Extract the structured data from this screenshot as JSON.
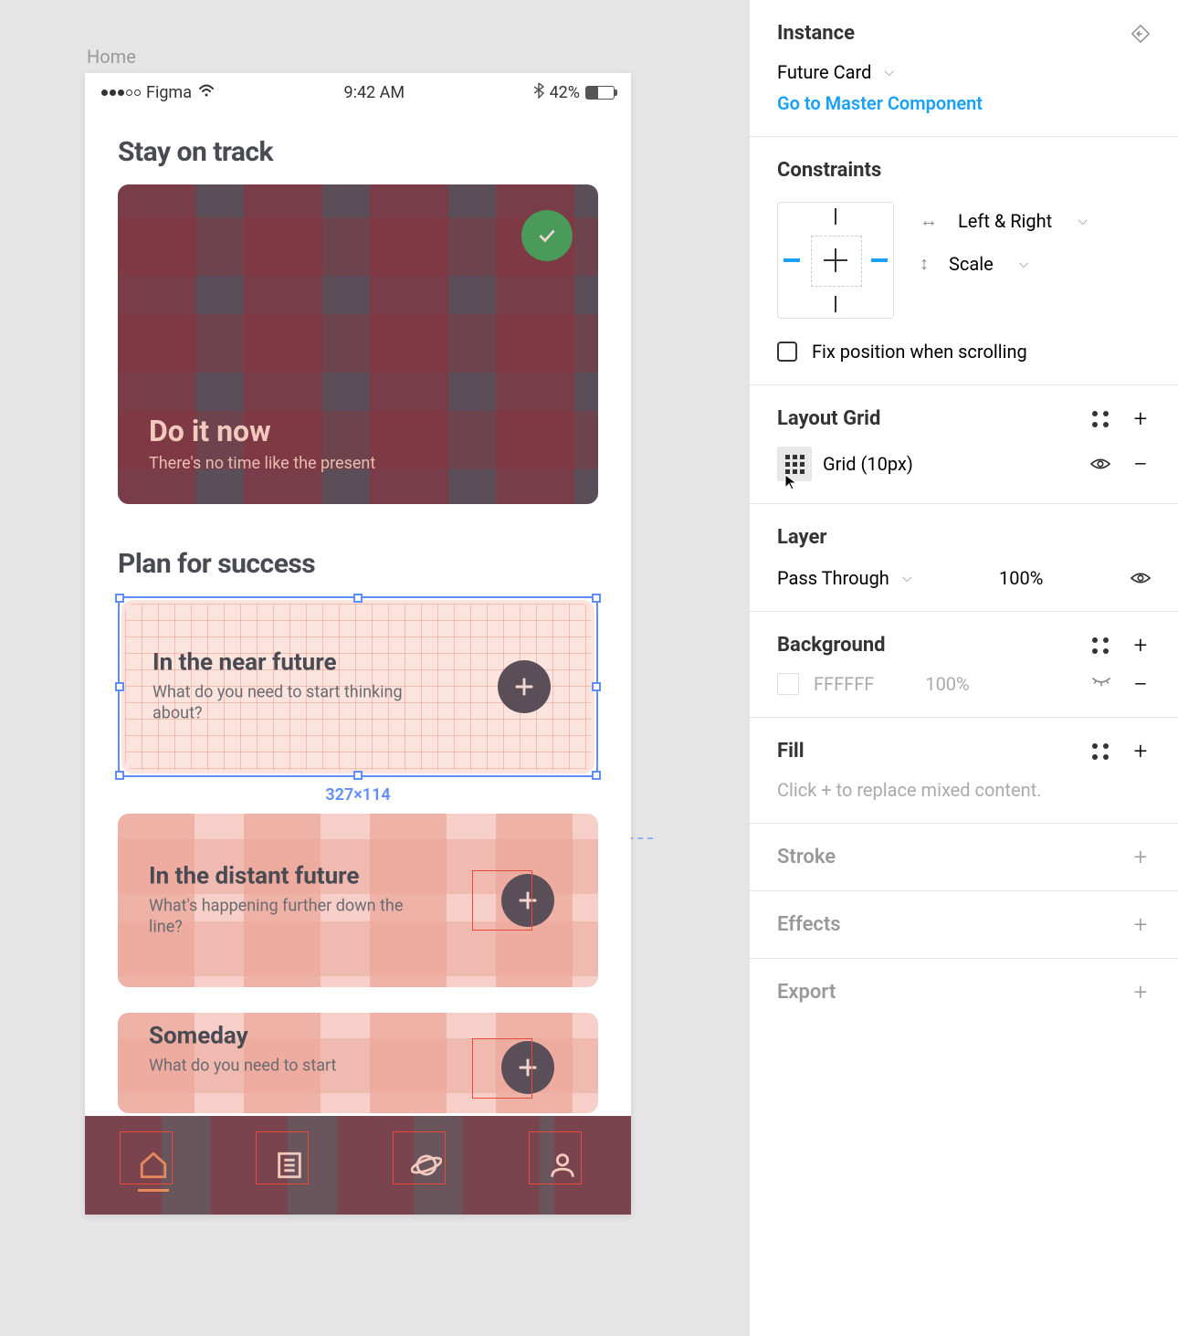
{
  "frame_label": "Home",
  "status_bar": {
    "carrier": "Figma",
    "time": "9:42 AM",
    "battery_pct": "42%"
  },
  "sections": {
    "track_title": "Stay on track",
    "plan_title": "Plan for success"
  },
  "hero": {
    "title": "Do it now",
    "subtitle": "There's no time like the present"
  },
  "future_cards": [
    {
      "title": "In the near future",
      "subtitle": "What do you need to start thinking about?",
      "selected": true
    },
    {
      "title": "In the distant future",
      "subtitle": "What's happening further down the line?",
      "selected": false
    },
    {
      "title": "Someday",
      "subtitle": "What do you need to start",
      "selected": false
    }
  ],
  "selection_dimensions": "327×114",
  "panel": {
    "instance": {
      "header": "Instance",
      "component_name": "Future Card",
      "master_link": "Go to Master Component"
    },
    "constraints": {
      "header": "Constraints",
      "horizontal": "Left & Right",
      "vertical": "Scale",
      "fix_label": "Fix position when scrolling"
    },
    "layout_grid": {
      "header": "Layout Grid",
      "value": "Grid (10px)"
    },
    "layer": {
      "header": "Layer",
      "blend": "Pass Through",
      "opacity": "100%"
    },
    "background": {
      "header": "Background",
      "hex": "FFFFFF",
      "opacity": "100%"
    },
    "fill": {
      "header": "Fill",
      "placeholder": "Click + to replace mixed content."
    },
    "stroke": {
      "header": "Stroke"
    },
    "effects": {
      "header": "Effects"
    },
    "export": {
      "header": "Export"
    }
  }
}
